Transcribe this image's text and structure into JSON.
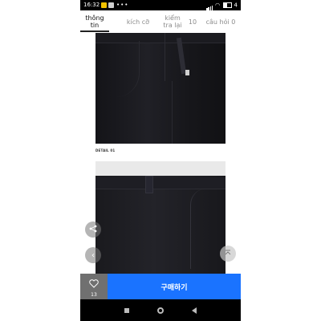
{
  "status_bar": {
    "time": "16:32",
    "dots": "•••",
    "battery": "4"
  },
  "tabs": [
    {
      "label": "thông tin"
    },
    {
      "label": "kích cỡ"
    },
    {
      "label": "kiểm tra lại"
    },
    {
      "label": "10"
    },
    {
      "label": "câu hỏi 0"
    }
  ],
  "content": {
    "caption": "DETAIL 01"
  },
  "bottom_bar": {
    "like_count": "13",
    "buy_label": "구매하기"
  },
  "colors": {
    "buy_button": "#1a73ff",
    "like_box": "#707070",
    "product": "#1c1c21"
  },
  "icons": {
    "share": "share-icon",
    "prev": "chevron-left-icon",
    "top": "scroll-top-icon",
    "like": "heart-icon"
  }
}
